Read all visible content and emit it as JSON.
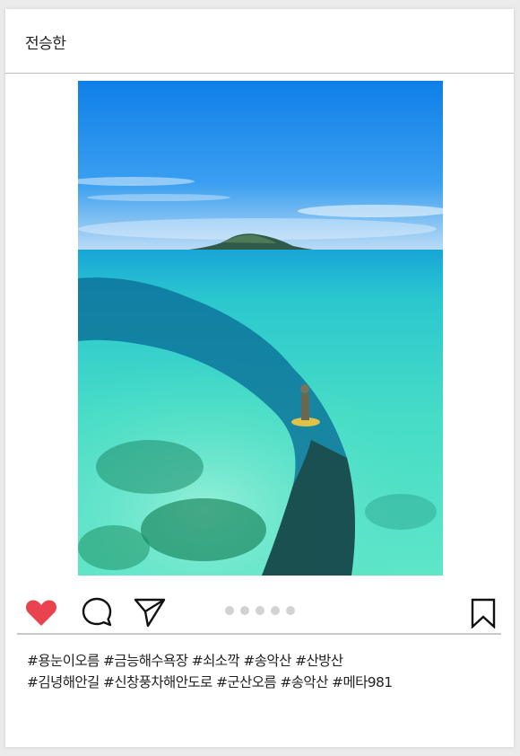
{
  "post": {
    "username": "전승한",
    "caption_lines": [
      "#용눈이오름 #금능해수욕장 #쇠소깍 #송악산 #산방산",
      "#김녕해안길 #신창풍차해안도로 #군산오름 #송악산 #메타981"
    ]
  },
  "actions": {
    "icons": [
      "heart-icon",
      "comment-icon",
      "share-icon",
      "bookmark-icon"
    ],
    "carousel_dot_count": 5
  },
  "colors": {
    "heart": "#e8434f",
    "icon_stroke": "#111111",
    "dot": "#d2d2d2",
    "sky": "#1f8ff0",
    "sea": "#2ecfc0"
  }
}
